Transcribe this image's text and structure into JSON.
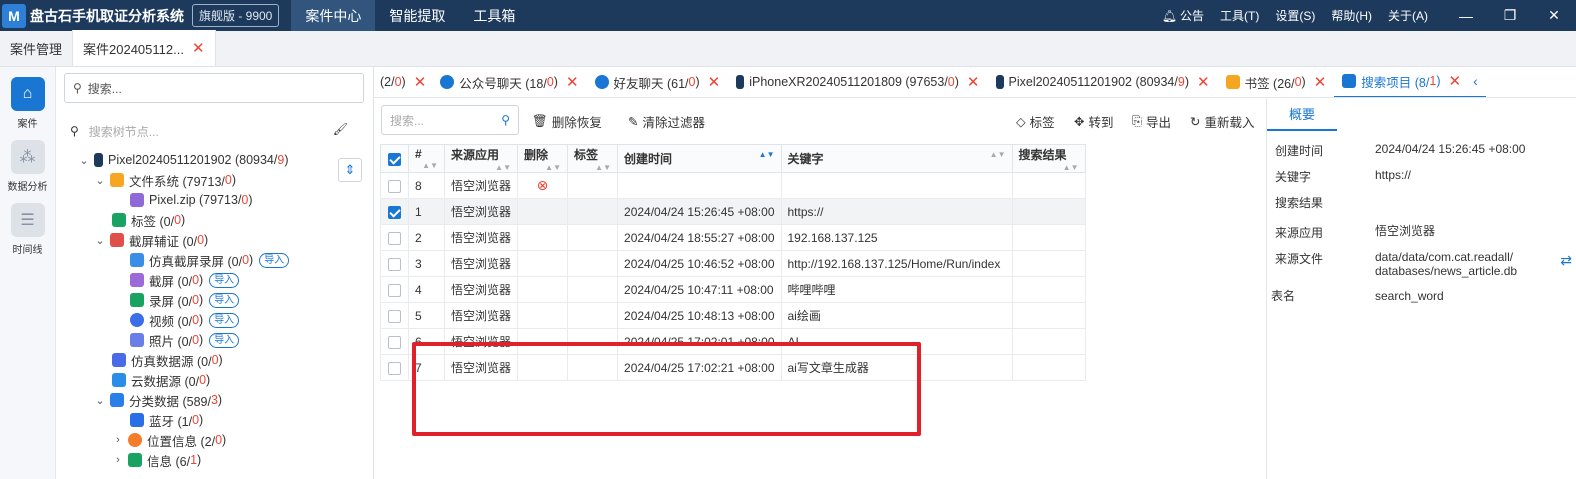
{
  "app": {
    "logo": "M",
    "title": "盘古石手机取证分析系统",
    "edition": "旗舰版 - 9900",
    "nav": [
      "案件中心",
      "智能提取",
      "工具箱"
    ],
    "menu": {
      "notice": "公告",
      "tools": "工具(T)",
      "settings": "设置(S)",
      "help": "帮助(H)",
      "about": "关于(A)"
    }
  },
  "doc_tabs": {
    "case_mgmt": "案件管理",
    "active_case": "案件202405112..."
  },
  "left_nav": [
    {
      "label": "案件",
      "icon": "home-icon"
    },
    {
      "label": "数据分析",
      "icon": "analysis-icon"
    },
    {
      "label": "时间线",
      "icon": "timeline-icon"
    }
  ],
  "tree": {
    "search_placeholder": "搜索...",
    "node_search_placeholder": "搜索树节点...",
    "nodes": [
      {
        "label": "Pixel20240511201902 (80934/",
        "badge": "9",
        "tail": ")",
        "import": ""
      },
      {
        "label": "文件系统 (79713/",
        "badge": "0",
        "tail": ")",
        "import": ""
      },
      {
        "label": "Pixel.zip (79713/",
        "badge": "0",
        "tail": ")",
        "import": ""
      },
      {
        "label": "标签 (0/",
        "badge": "0",
        "tail": ")",
        "import": ""
      },
      {
        "label": "截屏辅证 (0/",
        "badge": "0",
        "tail": ")",
        "import": ""
      },
      {
        "label": "仿真截屏录屏 (0/",
        "badge": "0",
        "tail": ")",
        "import": "导入"
      },
      {
        "label": "截屏 (0/",
        "badge": "0",
        "tail": ")",
        "import": "导入"
      },
      {
        "label": "录屏 (0/",
        "badge": "0",
        "tail": ")",
        "import": "导入"
      },
      {
        "label": "视频 (0/",
        "badge": "0",
        "tail": ")",
        "import": "导入"
      },
      {
        "label": "照片 (0/",
        "badge": "0",
        "tail": ")",
        "import": "导入"
      },
      {
        "label": "仿真数据源 (0/",
        "badge": "0",
        "tail": ")",
        "import": ""
      },
      {
        "label": "云数据源 (0/",
        "badge": "0",
        "tail": ")",
        "import": ""
      },
      {
        "label": "分类数据 (589/",
        "badge": "3",
        "tail": ")",
        "import": ""
      },
      {
        "label": "蓝牙 (1/",
        "badge": "0",
        "tail": ")",
        "import": ""
      },
      {
        "label": "位置信息 (2/",
        "badge": "0",
        "tail": ")",
        "import": ""
      },
      {
        "label": "信息 (6/",
        "badge": "1",
        "tail": ")",
        "import": ""
      }
    ]
  },
  "data_tabs": [
    {
      "label": "(2/",
      "badge": "0",
      "tail": ")"
    },
    {
      "label": "公众号聊天 (18/",
      "badge": "0",
      "tail": ")"
    },
    {
      "label": "好友聊天 (61/",
      "badge": "0",
      "tail": ")"
    },
    {
      "label": "iPhoneXR20240511201809 (97653/",
      "badge": "0",
      "tail": ")"
    },
    {
      "label": "Pixel20240511201902 (80934/",
      "badge": "9",
      "tail": ")"
    },
    {
      "label": "书签 (26/",
      "badge": "0",
      "tail": ")"
    },
    {
      "label": "搜索项目 (8/",
      "badge": "1",
      "tail": ")"
    }
  ],
  "toolbar": {
    "search_placeholder": "搜索...",
    "delete_restore": "删除恢复",
    "clear_filter": "清除过滤器",
    "tag": "标签",
    "goto": "转到",
    "export": "导出",
    "reload": "重新载入"
  },
  "table": {
    "headers": [
      "#",
      "来源应用",
      "删除",
      "标签",
      "创建时间",
      "关键字",
      "搜索结果"
    ],
    "rows": [
      {
        "num": "8",
        "app": "悟空浏览器",
        "deleted": true,
        "tag": "",
        "time": "",
        "keyword": "",
        "result": "",
        "checked": false
      },
      {
        "num": "1",
        "app": "悟空浏览器",
        "deleted": false,
        "tag": "",
        "time": "2024/04/24 15:26:45 +08:00",
        "keyword": "https://",
        "result": "",
        "checked": true
      },
      {
        "num": "2",
        "app": "悟空浏览器",
        "deleted": false,
        "tag": "",
        "time": "2024/04/24 18:55:27 +08:00",
        "keyword": "192.168.137.125",
        "result": "",
        "checked": false
      },
      {
        "num": "3",
        "app": "悟空浏览器",
        "deleted": false,
        "tag": "",
        "time": "2024/04/25 10:46:52 +08:00",
        "keyword": "http://192.168.137.125/Home/Run/index",
        "result": "",
        "checked": false
      },
      {
        "num": "4",
        "app": "悟空浏览器",
        "deleted": false,
        "tag": "",
        "time": "2024/04/25 10:47:11 +08:00",
        "keyword": "哔哩哔哩",
        "result": "",
        "checked": false
      },
      {
        "num": "5",
        "app": "悟空浏览器",
        "deleted": false,
        "tag": "",
        "time": "2024/04/25 10:48:13 +08:00",
        "keyword": "ai绘画",
        "result": "",
        "checked": false
      },
      {
        "num": "6",
        "app": "悟空浏览器",
        "deleted": false,
        "tag": "",
        "time": "2024/04/25 17:02:01 +08:00",
        "keyword": "AI",
        "result": "",
        "checked": false
      },
      {
        "num": "7",
        "app": "悟空浏览器",
        "deleted": false,
        "tag": "",
        "time": "2024/04/25 17:02:21 +08:00",
        "keyword": "ai写文章生成器",
        "result": "",
        "checked": false
      }
    ]
  },
  "detail": {
    "tab": "概要",
    "fields": [
      {
        "label": "创建时间",
        "value": "2024/04/24 15:26:45 +08:00"
      },
      {
        "label": "关键字",
        "value": "https://"
      },
      {
        "label": "搜索结果",
        "value": ""
      },
      {
        "label": "来源应用",
        "value": "悟空浏览器"
      },
      {
        "label": "来源文件",
        "value": "data/data/com.cat.readall/\ndatabases/news_article.db"
      },
      {
        "label": "表名",
        "value": "search_word"
      }
    ]
  },
  "colors": {
    "titlebar": "#1d3a5c",
    "accent": "#1976d2",
    "badge_red": "#e43",
    "highlight_box": "#e0202a"
  }
}
